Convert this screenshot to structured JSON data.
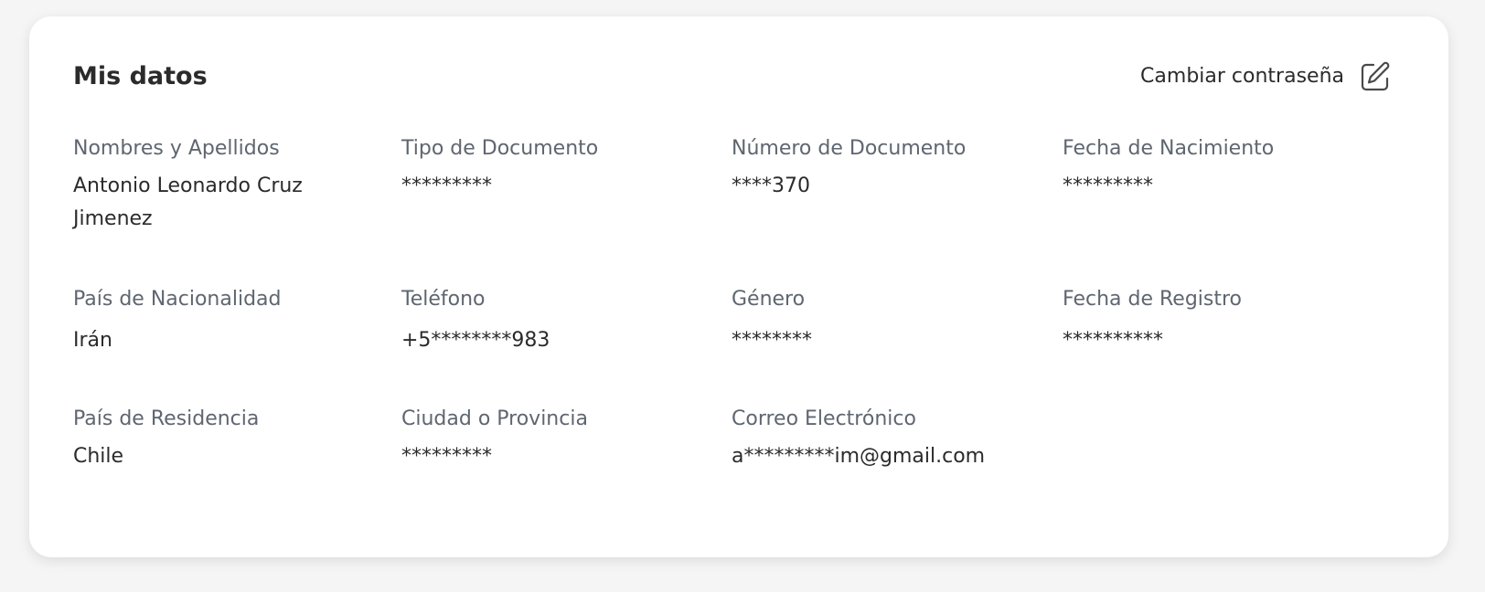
{
  "card": {
    "title": "Mis datos",
    "change_password_label": "Cambiar contraseña"
  },
  "fields": [
    {
      "label": "Nombres y Apellidos",
      "value": "Antonio Leonardo Cruz Jimenez"
    },
    {
      "label": "Tipo de Documento",
      "value": "*********"
    },
    {
      "label": "Número de Documento",
      "value": "****370"
    },
    {
      "label": "Fecha de Nacimiento",
      "value": "*********"
    },
    {
      "label": "País de Nacionalidad",
      "value": "Irán"
    },
    {
      "label": "Teléfono",
      "value": "+5********983"
    },
    {
      "label": "Género",
      "value": "********"
    },
    {
      "label": "Fecha de Registro",
      "value": "**********"
    },
    {
      "label": "País de Residencia",
      "value": "Chile"
    },
    {
      "label": "Ciudad o Provincia",
      "value": "*********"
    },
    {
      "label": "Correo Electrónico",
      "value": "a*********im@gmail.com"
    }
  ],
  "icons": {
    "edit": "edit-square-pencil-icon"
  },
  "colors": {
    "page_background": "#f5f5f5",
    "card_background": "#ffffff",
    "label": "#5f6670",
    "value": "#2b2b2b"
  }
}
